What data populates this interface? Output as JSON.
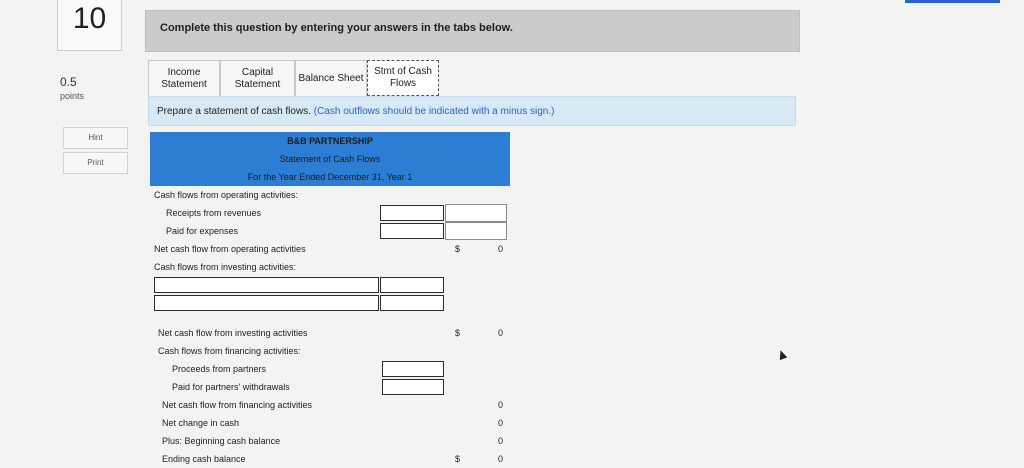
{
  "question": {
    "number": "10",
    "points_value": "0.5",
    "points_label": "points"
  },
  "side_buttons": {
    "hint": "Hint",
    "print": "Print"
  },
  "instruction": "Complete this question by entering your answers in the tabs below.",
  "tabs": [
    {
      "label": "Income Statement",
      "active": false
    },
    {
      "label": "Capital Statement",
      "active": false
    },
    {
      "label": "Balance Sheet",
      "active": false
    },
    {
      "label": "Stmt of Cash Flows",
      "active": true
    }
  ],
  "prompt": {
    "text": "Prepare a statement of cash flows.",
    "hint": "(Cash outflows should be indicated with a minus sign.)"
  },
  "statement": {
    "company": "B&B PARTNERSHIP",
    "title": "Statement of Cash Flows",
    "period": "For the Year Ended December 31, Year 1",
    "rows": {
      "op_header": "Cash flows from operating activities:",
      "receipts": "Receipts from revenues",
      "paid_expenses": "Paid for expenses",
      "net_op": "Net cash flow from operating activities",
      "inv_header": "Cash flows from investing activities:",
      "net_inv": "Net cash flow from investing activities",
      "fin_header": "Cash flows from financing activities:",
      "proceeds": "Proceeds from partners",
      "withdrawals": "Paid for partners' withdrawals",
      "net_fin": "Net cash flow from financing activities",
      "net_change": "Net change in cash",
      "beginning": "Plus: Beginning cash balance",
      "ending": "Ending cash balance"
    },
    "values": {
      "dollar": "$",
      "net_op": "0",
      "net_inv": "0",
      "net_fin": "0",
      "net_change": "0",
      "beginning": "0",
      "ending": "0"
    }
  }
}
